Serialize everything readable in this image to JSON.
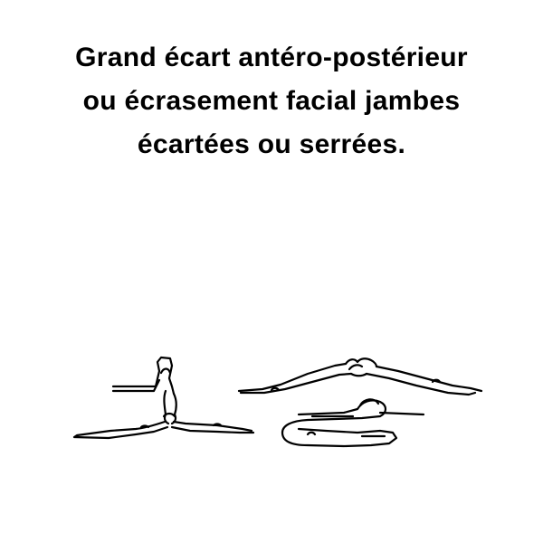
{
  "caption": {
    "lines": [
      "Grand écart antéro-postérieur",
      "ou écrasement facial jambes",
      "écartées ou serrées."
    ]
  },
  "figures": [
    {
      "icon": "split-side-view-figure"
    },
    {
      "icon": "face-down-legs-apart-figure"
    },
    {
      "icon": "face-down-legs-together-figure"
    }
  ]
}
